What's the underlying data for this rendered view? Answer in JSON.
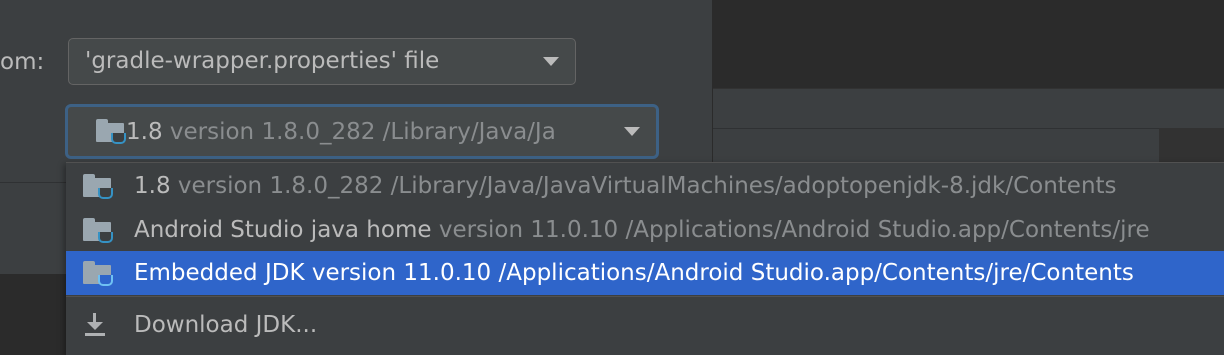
{
  "dialog": {
    "from_label": "om:",
    "gradle_combo": {
      "value": "'gradle-wrapper.properties' file"
    },
    "jdk_combo": {
      "name": "1.8",
      "detail": " version 1.8.0_282 /Library/Java/Ja"
    }
  },
  "jdk_popup": {
    "items": [
      {
        "name": "1.8",
        "detail": " version 1.8.0_282 /Library/Java/JavaVirtualMachines/adoptopenjdk-8.jdk/Contents",
        "icon": "jdk-folder-icon",
        "selected": false
      },
      {
        "name": "Android Studio java home",
        "detail": " version 11.0.10 /Applications/Android Studio.app/Contents/jre",
        "icon": "jdk-folder-icon",
        "selected": false
      },
      {
        "name": "Embedded JDK",
        "detail": " version 11.0.10 /Applications/Android Studio.app/Contents/jre/Contents",
        "icon": "jdk-folder-icon",
        "selected": true
      }
    ],
    "download_label": "Download JDK...",
    "download_icon": "download-icon"
  },
  "colors": {
    "background": "#3c3f41",
    "selection": "#2f65ca",
    "focus_border": "#3d6185",
    "text": "#bbbbbb",
    "detail_text": "#8a8d8f"
  }
}
